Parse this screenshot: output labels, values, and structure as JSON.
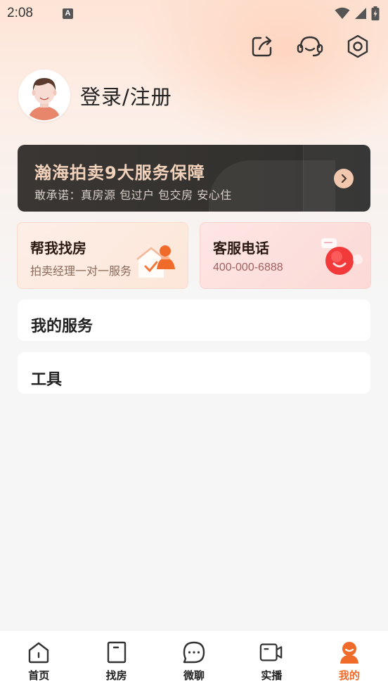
{
  "status_bar": {
    "time": "2:08",
    "notification_letter": "A"
  },
  "profile": {
    "login_label": "登录/注册"
  },
  "banner": {
    "title": "瀚海拍卖9大服务保障",
    "subtitle": "敢承诺：真房源 包过户 包交房 安心住"
  },
  "cards": [
    {
      "title": "帮我找房",
      "subtitle": "拍卖经理一对一服务"
    },
    {
      "title": "客服电话",
      "subtitle": "400-000-6888"
    }
  ],
  "sections": {
    "my_services": "我的服务",
    "tools": "工具"
  },
  "bottom_nav": [
    {
      "label": "首页",
      "icon": "home-icon",
      "active": false
    },
    {
      "label": "找房",
      "icon": "find-house-icon",
      "active": false
    },
    {
      "label": "微聊",
      "icon": "chat-icon",
      "active": false
    },
    {
      "label": "实播",
      "icon": "video-icon",
      "active": false
    },
    {
      "label": "我的",
      "icon": "profile-icon",
      "active": true
    }
  ],
  "colors": {
    "accent": "#f06a2a",
    "banner_bg": "#34322f",
    "banner_title": "#f3d2bb"
  }
}
